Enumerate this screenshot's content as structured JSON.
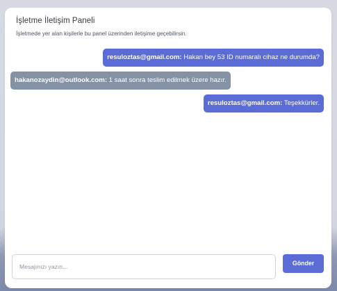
{
  "panel": {
    "title": "İşletme İletişim Paneli",
    "subtitle": "İşletmede yer alan kişilerle bu panel üzerinden iletişime geçebilirsin."
  },
  "messages": [
    {
      "direction": "outgoing",
      "sender": "resuloztas@gmail.com:",
      "text": " Hakan bey 53 ID numaralı cihaz ne durumda?"
    },
    {
      "direction": "incoming",
      "sender": "hakanozaydin@outlook.com:",
      "text": " 1 saat sonra teslim edilmek üzere hazır."
    },
    {
      "direction": "outgoing",
      "sender": "resuloztas@gmail.com:",
      "text": " Teşekkürler."
    }
  ],
  "composer": {
    "placeholder": "Mesajınızı yazın...",
    "value": "",
    "send_label": "Gönder"
  },
  "colors": {
    "accent": "#5b6cd6",
    "incoming_bubble": "#8592a6",
    "panel_bg": "#ffffff"
  }
}
